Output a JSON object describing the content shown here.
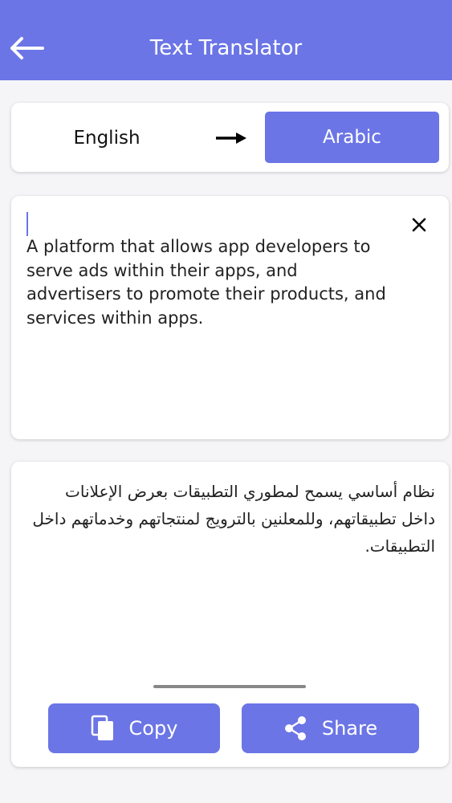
{
  "header": {
    "title": "Text Translator",
    "back_icon": "arrow-left-icon",
    "color": "#6b75e6"
  },
  "languages": {
    "source": "English",
    "target": "Arabic",
    "arrow_icon": "arrow-right-icon"
  },
  "input": {
    "text": "A platform that allows app developers to serve ads within their apps, and advertisers to promote their products, and services within apps.",
    "clear_icon": "close-icon"
  },
  "output": {
    "text": "نظام أساسي يسمح لمطوري التطبيقات بعرض الإعلانات داخل تطبيقاتهم، وللمعلنين بالترويج لمنتجاتهم وخدماتهم داخل التطبيقات."
  },
  "actions": {
    "copy_label": "Copy",
    "copy_icon": "copy-icon",
    "share_label": "Share",
    "share_icon": "share-icon"
  }
}
